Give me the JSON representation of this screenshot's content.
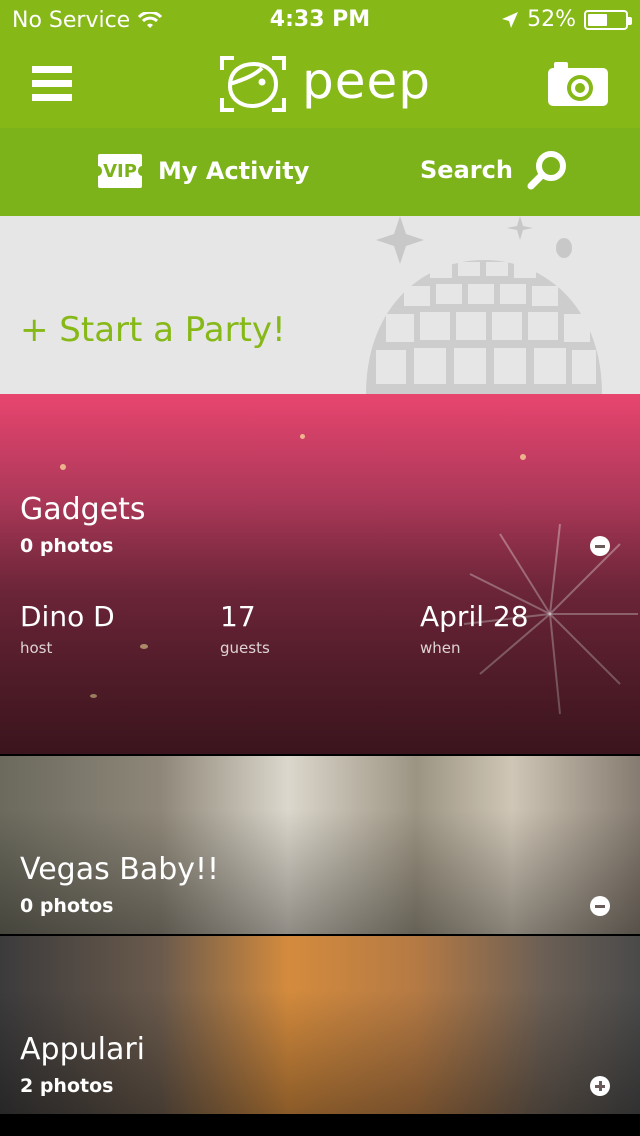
{
  "status_bar": {
    "carrier": "No Service",
    "time": "4:33 PM",
    "battery_percent": "52%",
    "battery_level": 0.52
  },
  "header": {
    "app_name": "peep"
  },
  "sub_nav": {
    "vip_badge": "VIP",
    "activity_label": "My Activity",
    "search_label": "Search"
  },
  "start_party": {
    "label": "+ Start a Party!"
  },
  "parties": [
    {
      "title": "Gadgets",
      "photo_count": "0 photos",
      "host_value": "Dino D",
      "host_label": "host",
      "guests_value": "17",
      "guests_label": "guests",
      "when_value": "April 28",
      "when_label": "when",
      "toggle": "minus-icon"
    },
    {
      "title": "Vegas Baby!!",
      "photo_count": "0 photos",
      "toggle": "minus-icon"
    },
    {
      "title": "Appulari",
      "photo_count": "2 photos",
      "toggle": "plus-icon"
    }
  ],
  "colors": {
    "brand_green": "#86b817",
    "subnav_green": "#7cb31a",
    "panel_gray": "#e6e6e6"
  }
}
